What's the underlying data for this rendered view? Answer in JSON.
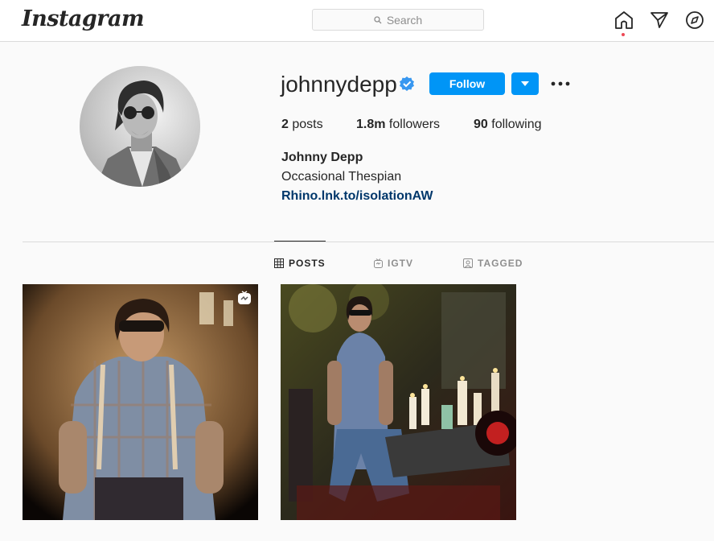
{
  "nav": {
    "logo": "Instagram",
    "search_placeholder": "Search",
    "icons": [
      "home-icon",
      "direct-icon",
      "explore-icon"
    ]
  },
  "profile": {
    "username": "johnnydepp",
    "verified": true,
    "follow_label": "Follow",
    "stats": {
      "posts_count": "2",
      "posts_label": "posts",
      "followers_count": "1.8m",
      "followers_label": "followers",
      "following_count": "90",
      "following_label": "following"
    },
    "full_name": "Johnny Depp",
    "bio": "Occasional Thespian",
    "link": "Rhino.lnk.to/isolationAW"
  },
  "tabs": [
    {
      "label": "POSTS",
      "active": true
    },
    {
      "label": "IGTV",
      "active": false
    },
    {
      "label": "TAGGED",
      "active": false
    }
  ],
  "posts": [
    {
      "type": "igtv"
    },
    {
      "type": "photo"
    }
  ],
  "colors": {
    "accent": "#0095f6",
    "link": "#00376b",
    "notification": "#ed4956"
  }
}
